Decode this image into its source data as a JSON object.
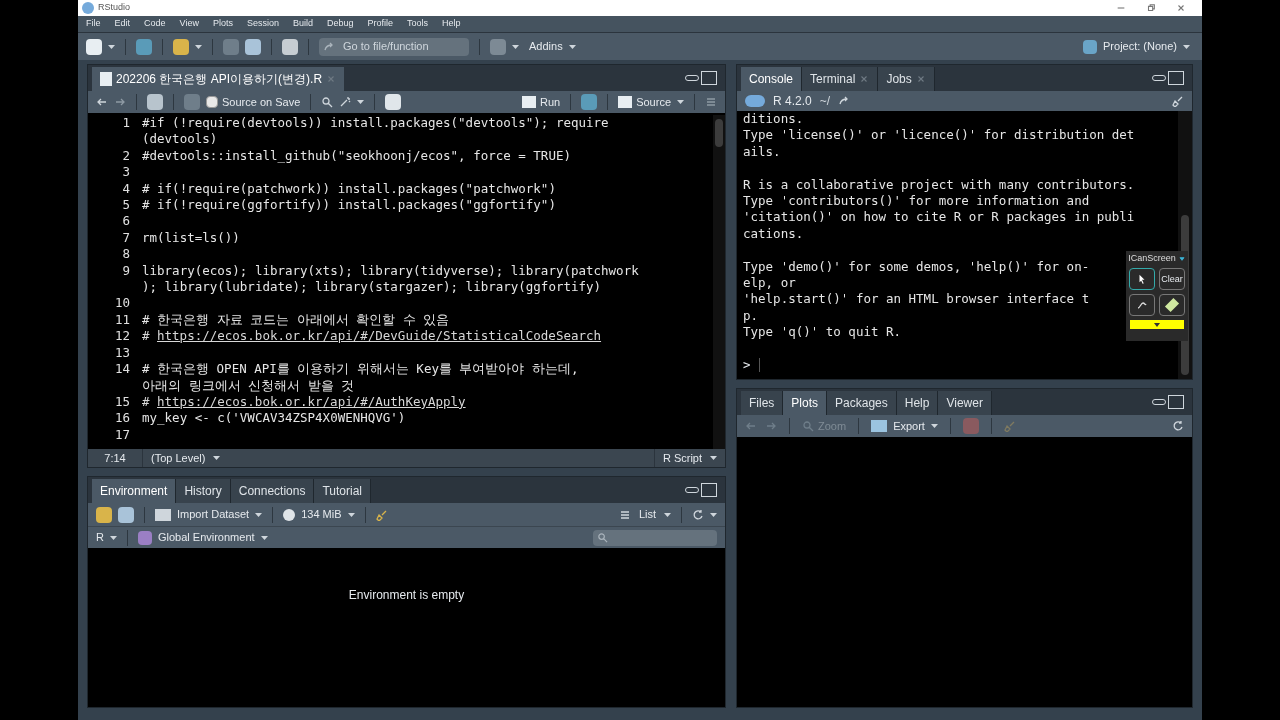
{
  "window": {
    "title": "RStudio"
  },
  "menu": [
    "File",
    "Edit",
    "Code",
    "View",
    "Plots",
    "Session",
    "Build",
    "Debug",
    "Profile",
    "Tools",
    "Help"
  ],
  "toolbar": {
    "goto_placeholder": "Go to file/function",
    "addins": "Addins",
    "project": "Project: (None)"
  },
  "source": {
    "tab": {
      "label": "202206 한국은행 API이용하기(변경).R",
      "selected": true
    },
    "source_on_save": {
      "label": "Source on Save",
      "checked": false
    },
    "run": "Run",
    "source_button": "Source",
    "lines": [
      {
        "number": "1",
        "rows": [
          "#if (!require(devtools)) install.packages(\"devtools\"); require",
          "(devtools)"
        ]
      },
      {
        "number": "2",
        "rows": [
          "#devtools::install_github(\"seokhoonj/ecos\", force = TRUE)"
        ]
      },
      {
        "number": "3"
      },
      {
        "number": "4",
        "rows": [
          "# if(!require(patchwork)) install.packages(\"patchwork\")"
        ]
      },
      {
        "number": "5",
        "rows": [
          "# if(!require(ggfortify)) install.packages(\"ggfortify\")"
        ]
      },
      {
        "number": "6"
      },
      {
        "number": "7",
        "rows": [
          "rm(list=ls())"
        ]
      },
      {
        "number": "8"
      },
      {
        "number": "9",
        "rows": [
          "library(ecos); library(xts); library(tidyverse); library(patchwork",
          "); library(lubridate); library(stargazer); library(ggfortify)"
        ]
      },
      {
        "number": "10"
      },
      {
        "number": "11",
        "rows": [
          "# 한국은행 자료 코드는 아래에서 확인할 수 있음"
        ]
      },
      {
        "number": "12",
        "kind": "link",
        "prefix": "#",
        "rows": [
          "https://ecos.bok.or.kr/api/#/DevGuide/StatisticalCodeSearch"
        ]
      },
      {
        "number": "13"
      },
      {
        "number": "14",
        "rows": [
          "# 한국은행 OPEN API를 이용하기 위해서는 Key를 부여받아야 하는데,",
          "아래의 링크에서 신청해서 받을 것"
        ]
      },
      {
        "number": "15",
        "kind": "link",
        "prefix": "#",
        "rows": [
          "https://ecos.bok.or.kr/api/#/AuthKeyApply"
        ]
      },
      {
        "number": "16",
        "rows": [
          "my_key <- c('VWCAV34ZSP4X0WENHQVG')"
        ]
      },
      {
        "number": "17"
      }
    ],
    "status": {
      "position": "7:14",
      "scope": "(Top Level)",
      "type": "R Script"
    }
  },
  "environment": {
    "tabs": [
      {
        "label": "Environment",
        "selected": true
      },
      {
        "label": "History",
        "selected": false
      },
      {
        "label": "Connections",
        "selected": false
      },
      {
        "label": "Tutorial",
        "selected": false
      }
    ],
    "import": "Import Dataset",
    "memory": "134 MiB",
    "view": "List",
    "language": "R",
    "scope": "Global Environment",
    "empty": "Environment is empty"
  },
  "console": {
    "tabs": [
      {
        "label": "Console",
        "selected": true,
        "closable": false
      },
      {
        "label": "Terminal",
        "selected": false,
        "closable": true
      },
      {
        "label": "Jobs",
        "selected": false,
        "closable": true
      }
    ],
    "version": "R 4.2.0",
    "path": "~/",
    "rows": [
      "ditions.",
      "Type 'license()' or 'licence()' for distribution det",
      "ails.",
      "",
      "R is a collaborative project with many contributors.",
      "Type 'contributors()' for more information and",
      "'citation()' on how to cite R or R packages in publi",
      "cations.",
      "",
      "Type 'demo()' for some demos, 'help()' for on-",
      "elp, or",
      "'help.start()' for an HTML browser interface t",
      "p.",
      "Type 'q()' to quit R.",
      ""
    ],
    "prompt": ">"
  },
  "overlay": {
    "title": "ICanScreen",
    "clear": "Clear"
  },
  "files": {
    "tabs": [
      {
        "label": "Files",
        "selected": false
      },
      {
        "label": "Plots",
        "selected": true
      },
      {
        "label": "Packages",
        "selected": false
      },
      {
        "label": "Help",
        "selected": false
      },
      {
        "label": "Viewer",
        "selected": false
      }
    ],
    "zoom": "Zoom",
    "export": "Export"
  }
}
